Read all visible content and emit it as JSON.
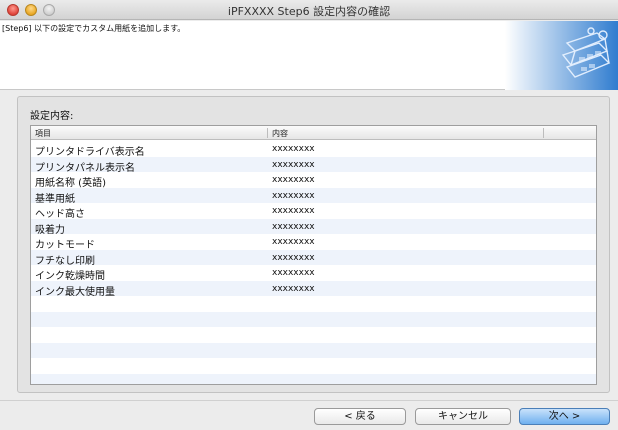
{
  "window": {
    "title": "iPFXXXX Step6 設定内容の確認"
  },
  "header": {
    "instruction": "[Step6] 以下の設定でカスタム用紙を追加します。"
  },
  "settings": {
    "group_label": "設定内容:",
    "columns": [
      "項目",
      "内容"
    ],
    "rows": [
      {
        "item": "プリンタドライバ表示名",
        "value": "xxxxxxxx"
      },
      {
        "item": "プリンタパネル表示名",
        "value": "xxxxxxxx"
      },
      {
        "item": "用紙名称 (英語)",
        "value": "xxxxxxxx"
      },
      {
        "item": "基準用紙",
        "value": "xxxxxxxx"
      },
      {
        "item": "ヘッド高さ",
        "value": "xxxxxxxx"
      },
      {
        "item": "吸着力",
        "value": "xxxxxxxx"
      },
      {
        "item": "カットモード",
        "value": "xxxxxxxx"
      },
      {
        "item": "フチなし印刷",
        "value": "xxxxxxxx"
      },
      {
        "item": "インク乾燥時間",
        "value": "xxxxxxxx"
      },
      {
        "item": "インク最大使用量",
        "value": "xxxxxxxx"
      }
    ]
  },
  "buttons": {
    "back": "< 戻る",
    "cancel": "キャンセル",
    "next": "次へ >"
  },
  "colors": {
    "accent": "#6fb0ef",
    "header_art": "#3a86d4"
  },
  "icons": {
    "header_art": "printer-paper-roll-icon"
  }
}
